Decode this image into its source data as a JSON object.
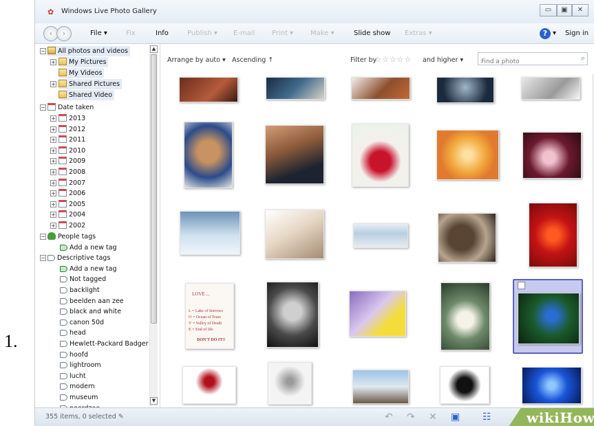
{
  "step_number": "1.",
  "window": {
    "title": "Windows Live Photo Gallery",
    "controls": [
      "▭",
      "▣",
      "✕"
    ]
  },
  "menu": {
    "items": [
      {
        "label": "File ▾",
        "active": true
      },
      {
        "label": "Fix",
        "active": false
      },
      {
        "label": "Info",
        "active": true
      },
      {
        "label": "Publish ▾",
        "active": false
      },
      {
        "label": "E-mail",
        "active": false
      },
      {
        "label": "Print ▾",
        "active": false
      },
      {
        "label": "Make ▾",
        "active": false
      },
      {
        "label": "Slide show",
        "active": true
      },
      {
        "label": "Extras ▾",
        "active": false
      }
    ],
    "help_label": "?",
    "help_dropdown": "▾",
    "sign_in": "Sign in"
  },
  "sidebar": {
    "library": [
      {
        "label": "All photos and videos",
        "expander": "⊟",
        "icon": "photos",
        "selected": true
      },
      {
        "label": "My Pictures",
        "expander": "⊞",
        "icon": "folder",
        "selected": true
      },
      {
        "label": "My Videos",
        "expander": "",
        "icon": "folder",
        "selected": true
      },
      {
        "label": "Shared Pictures",
        "expander": "⊞",
        "icon": "folder",
        "selected": true
      },
      {
        "label": "Shared Video",
        "expander": "",
        "icon": "folder",
        "selected": true
      }
    ],
    "date_taken_label": "Date taken",
    "years": [
      "2013",
      "2012",
      "2011",
      "2010",
      "2009",
      "2008",
      "2007",
      "2006",
      "2005",
      "2004",
      "2002"
    ],
    "people_tags_label": "People tags",
    "people_add": "Add a new tag",
    "descriptive_tags_label": "Descriptive tags",
    "descriptive_add": "Add a new tag",
    "not_tagged": "Not tagged",
    "tags": [
      "backlight",
      "beelden aan zee",
      "black and white",
      "canon 50d",
      "head",
      "Hewlett-Packard Badger",
      "hoofd",
      "lightroom",
      "lucht",
      "modern",
      "museum",
      "noordzee"
    ]
  },
  "toolbar": {
    "arrange": "Arrange by auto ▾",
    "ascending": "Ascending",
    "filter": "Filter by",
    "stars": "☆☆☆☆☆",
    "and_higher": "and higher ▾",
    "search_placeholder": "Find a photo"
  },
  "thumbnails": [
    {
      "name": "thumb-row0-1",
      "bg": "linear-gradient(135deg,#6a2d1d,#b65b3c 60%,#3a1a12)"
    },
    {
      "name": "thumb-row0-2",
      "bg": "linear-gradient(135deg,#1a2c44,#406a8c 50%,#d7d2c3)"
    },
    {
      "name": "thumb-row0-3",
      "bg": "linear-gradient(135deg,#f2efe9,#8d4f2f 55%,#c56a34)"
    },
    {
      "name": "thumb-row0-4",
      "bg": "radial-gradient(circle at 50% 40%,#a0b6c9,#1b2a3c 70%)"
    },
    {
      "name": "thumb-row0-5",
      "bg": "linear-gradient(135deg,#e8e8e8,#9a9a9a 60%,#f7f7f7)"
    },
    {
      "name": "thumb-dog-toy",
      "bg": "radial-gradient(circle at 50% 45%,#c89262 25%,#2b4b8a 60%,#e6e6e6)"
    },
    {
      "name": "thumb-tattoo",
      "bg": "linear-gradient(160deg,#d29c76,#8b5a3a 40%,#1d2330 75%)"
    },
    {
      "name": "thumb-red-rose-card",
      "bg": "radial-gradient(circle at 50% 60%,#c8142b 22%,#f4f0ec 45%,#eaf3ea)"
    },
    {
      "name": "thumb-peach-rose",
      "bg": "radial-gradient(circle at 50% 50%,#fde0a3 10%,#f2a73c 45%,#e07a2f 70%)"
    },
    {
      "name": "thumb-pink-roses",
      "bg": "radial-gradient(circle at 45% 55%,#f2c1cf 15%,#6b1a2e 50%,#2b0b13)"
    },
    {
      "name": "thumb-pelicans",
      "bg": "linear-gradient(180deg,#6d93b8,#cfe0ee 55%,#eef5fb)"
    },
    {
      "name": "thumb-beach-sit",
      "bg": "linear-gradient(150deg,#fff,#e7d8c6 45%,#a58c73)"
    },
    {
      "name": "thumb-banknote",
      "bg": "linear-gradient(180deg,#e7eef5,#b9cfe2 40%,#e8ecef)"
    },
    {
      "name": "thumb-monkey-bear",
      "bg": "radial-gradient(circle at 40% 50%,#5a4535 30%,#b7a48f 60%,#2e2620)"
    },
    {
      "name": "thumb-red-hearts",
      "bg": "radial-gradient(circle at 50% 50%,#ff5a1f 15%,#c41414 45%,#7a0a0a)"
    },
    {
      "name": "thumb-love-card",
      "bg": "#fbf8f4"
    },
    {
      "name": "thumb-child-bw",
      "bg": "radial-gradient(circle at 50% 45%,#cfcfcf 20%,#4a4a4a 55%,#111)"
    },
    {
      "name": "thumb-good-morning",
      "bg": "linear-gradient(135deg,#8c6bc0,#d9c8ee 45%,#f4dd3b 70%)"
    },
    {
      "name": "thumb-white-rose",
      "bg": "radial-gradient(circle at 50% 55%,#f5f3e8 18%,#6e8a6a 45%,#2a3a2a)"
    },
    {
      "name": "thumb-blue-jay",
      "bg": "radial-gradient(circle at 55% 45%,#2a6dd0 12%,#1b5a2a 45%,#0b2210)"
    },
    {
      "name": "thumb-red-rose-white",
      "bg": "radial-gradient(circle at 50% 40%,#b0101c 14%,#fff 40%)"
    },
    {
      "name": "thumb-sketch-man",
      "bg": "radial-gradient(circle at 50% 45%,#9a9a9a 10%,#f4f4f4 50%)"
    },
    {
      "name": "thumb-elephants",
      "bg": "linear-gradient(180deg,#9ec3e6,#dfe8ef 50%,#6b5a4a)"
    },
    {
      "name": "thumb-black-rose",
      "bg": "radial-gradient(circle at 50% 50%,#111 25%,#fff 55%)"
    },
    {
      "name": "thumb-blue-rose",
      "bg": "radial-gradient(circle at 50% 50%,#8fc8ff 10%,#1a55d8 45%,#061a5a)"
    }
  ],
  "love_card": {
    "title": "LOVE ...",
    "lines": [
      "L = Lake of Sorrows",
      "O = Ocean of Tears",
      "V = Valley of Death",
      "E = End of life"
    ],
    "footer": "DON'T DO IT!!"
  },
  "status": {
    "text": "355 items, 0 selected",
    "icons": [
      "↶",
      "↷",
      "✕",
      "▣",
      "☷"
    ],
    "watermark": "wikiHow"
  }
}
